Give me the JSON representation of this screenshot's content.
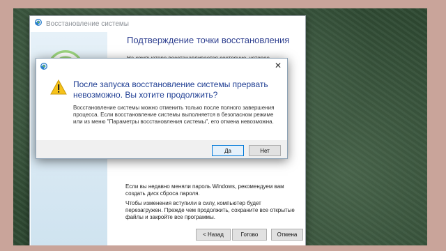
{
  "wizard": {
    "title": "Восстановление системы",
    "heading": "Подтверждение точки восстановления",
    "intro": "На компьютере восстанавливается состояние, которое",
    "password_note": "Если вы недавно меняли пароль Windows, рекомендуем вам создать диск сброса пароля.",
    "reboot_note": "Чтобы изменения вступили в силу, компьютер будет перезагружен. Прежде чем продолжить, сохраните все открытые файлы и закройте все программы.",
    "back_label": "< Назад",
    "finish_label": "Готово",
    "cancel_label": "Отмена"
  },
  "dialog": {
    "question": "После запуска восстановление системы прервать невозможно. Вы хотите продолжить?",
    "message": "Восстановление системы можно отменить только после полного завершения процесса. Если восстановление системы выполняется в безопасном режиме или из меню \"Параметры восстановления системы\", его отмена невозможна.",
    "yes_label": "Да",
    "no_label": "Нет",
    "close_label": "✕"
  },
  "icons": {
    "window_icon": "system-restore-icon",
    "warning_icon": "warning-icon"
  },
  "colors": {
    "accent": "#2e3f8f",
    "warning": "#f6c21a"
  }
}
